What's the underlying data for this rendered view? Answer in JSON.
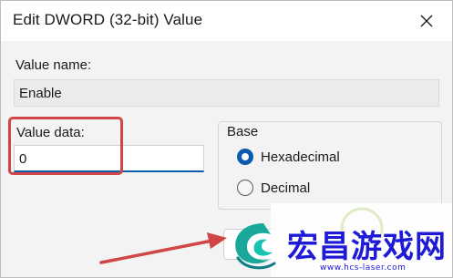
{
  "dialog": {
    "title": "Edit DWORD (32-bit) Value",
    "value_name_label": "Value name:",
    "value_name": "Enable",
    "value_data_label": "Value data:",
    "value_data": "0",
    "base_label": "Base",
    "base_options": [
      {
        "label": "Hexadecimal",
        "selected": true
      },
      {
        "label": "Decimal",
        "selected": false
      }
    ]
  },
  "colors": {
    "accent": "#0b5cad",
    "highlight": "#d04545",
    "arrow": "#d04545",
    "watermark": "#1e1ad6"
  },
  "watermark": {
    "text": "宏昌游戏网",
    "url": "www.hcs-laser.com"
  }
}
